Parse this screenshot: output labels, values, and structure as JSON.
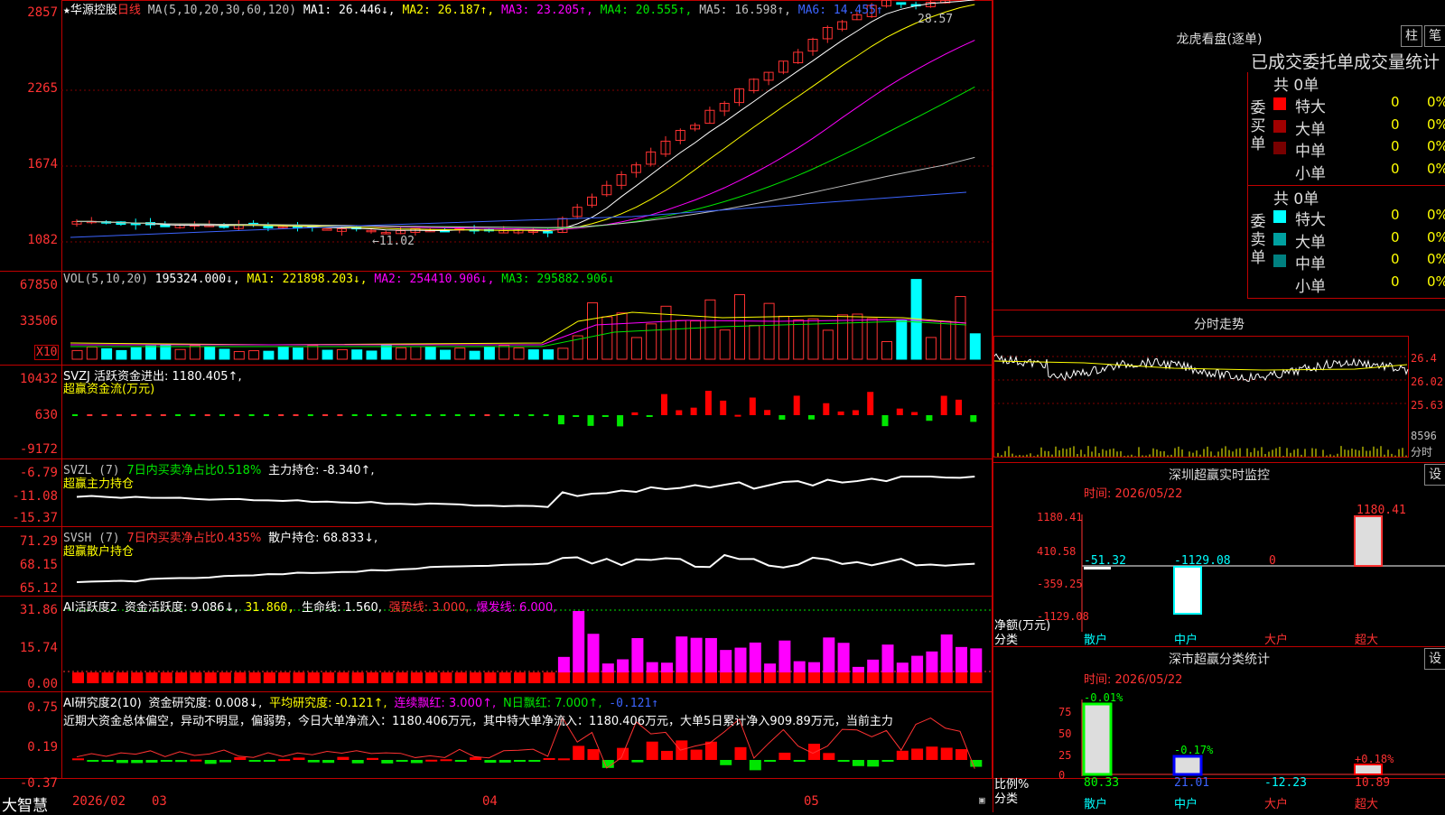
{
  "header": {
    "star": "★",
    "stock_name": "华源控股",
    "period": "日线",
    "ma_params": "MA(5,10,20,30,60,120)",
    "ma": [
      {
        "label": "MA1: 26.446↓,",
        "color": "#ffffff"
      },
      {
        "label": "MA2: 26.187↑,",
        "color": "#ffff00"
      },
      {
        "label": "MA3: 23.205↑,",
        "color": "#ff00ff"
      },
      {
        "label": "MA4: 20.555↑,",
        "color": "#00e600"
      },
      {
        "label": "MA5: 16.598↑,",
        "color": "#c0c0c0"
      },
      {
        "label": "MA6: 14.455↑",
        "color": "#3c64ff"
      }
    ]
  },
  "main_chart": {
    "y_ticks": [
      "2857",
      "2265",
      "1674",
      "1082"
    ],
    "high_label": "28.57",
    "low_label": "←11.02"
  },
  "vol_panel": {
    "title": "VOL(5,10,20)",
    "value": "195324.000↓,",
    "ma1": "MA1: 221898.203↓,",
    "ma2": "MA2: 254410.906↓,",
    "ma3": "MA3: 295882.906↓",
    "y_ticks": [
      "67850",
      "33506"
    ],
    "x10": "X10"
  },
  "svzj_panel": {
    "title": "SVZJ  活跃资金进出: 1180.405↑,",
    "subtitle": "超赢资金流(万元)",
    "y_ticks": [
      "10432",
      "630",
      "-9172"
    ]
  },
  "svzl_panel": {
    "title": "SVZL (7)",
    "ratio": "7日内买卖净占比0.518%",
    "hold": "主力持仓: -8.340↑,",
    "subtitle": "超赢主力持仓",
    "y_ticks": [
      "-6.79",
      "-11.08",
      "-15.37"
    ]
  },
  "svsh_panel": {
    "title": "SVSH (7)",
    "ratio": "7日内买卖净占比0.435%",
    "hold": "散户持仓: 68.833↓,",
    "subtitle": "超赢散户持仓",
    "y_ticks": [
      "71.29",
      "68.15",
      "65.12"
    ]
  },
  "ai2_panel": {
    "title": "AI活跃度2",
    "active": "资金活跃度: 9.086↓,",
    "v1": "31.860,",
    "life": "生命线: 1.560,",
    "strong": "强势线: 3.000,",
    "burst": "爆发线: 6.000,",
    "y_ticks": [
      "31.86",
      "15.74",
      "0.00"
    ]
  },
  "ai_research_panel": {
    "title": "AI研究度2(10)",
    "research": "资金研究度: 0.008↓,",
    "avg": "平均研究度: -0.121↑,",
    "red_days": "连续飘红: 3.000↑,",
    "n_red": "N日飘红: 7.000↑,",
    "last": "-0.121↑",
    "comment": "近期大资金总体偏空，异动不明显，偏弱势，今日大单净流入：1180.406万元，其中特大单净流入：1180.406万元，大单5日累计净入909.89万元，当前主力",
    "y_ticks": [
      "0.75",
      "0.19",
      "-0.37"
    ]
  },
  "x_axis": {
    "brand": "大智慧",
    "labels": [
      "2026/02",
      "03",
      "04",
      "05"
    ]
  },
  "right_panel": {
    "title": "龙虎看盘(逐单)",
    "btn_bar": "柱",
    "btn_tick": "笔",
    "table_title": "已成交委托单成交量统计",
    "buy_caption": [
      "委",
      "买",
      "单"
    ],
    "sell_caption": [
      "委",
      "卖",
      "单"
    ],
    "buy_total": "共 0单",
    "sell_total": "共 0单",
    "buy_rows": [
      {
        "label": "特大",
        "count": "0",
        "pct": "0%",
        "color": "#ff0000"
      },
      {
        "label": "大单",
        "count": "0",
        "pct": "0%",
        "color": "#a00000"
      },
      {
        "label": "中单",
        "count": "0",
        "pct": "0%",
        "color": "#780000"
      },
      {
        "label": "小单",
        "count": "0",
        "pct": "0%",
        "color": ""
      }
    ],
    "sell_rows": [
      {
        "label": "特大",
        "count": "0",
        "pct": "0%",
        "color": "#00ffff"
      },
      {
        "label": "大单",
        "count": "0",
        "pct": "0%",
        "color": "#00a0a0"
      },
      {
        "label": "中单",
        "count": "0",
        "pct": "0%",
        "color": "#008080"
      },
      {
        "label": "小单",
        "count": "0",
        "pct": "0%",
        "color": ""
      }
    ],
    "intraday_title": "分时走势",
    "intraday_ticks": [
      "26.4",
      "26.02",
      "25.63"
    ],
    "intraday_vol": "8596",
    "intraday_label": "分时",
    "monitor_title": "深圳超赢实时监控",
    "monitor_btn": "设",
    "monitor_time": "时间: 2026/05/22",
    "monitor_y": [
      "1180.41",
      "410.58",
      "-359.25",
      "-1129.08"
    ],
    "monitor_values": [
      "-51.32",
      "-1129.08",
      "0",
      "1180.41"
    ],
    "monitor_cats": [
      "散户",
      "中户",
      "大户",
      "超大"
    ],
    "monitor_ylabel": "净额(万元)",
    "monitor_xlabel": "分类",
    "stat_title": "深市超赢分类统计",
    "stat_btn": "设",
    "stat_time": "时间: 2026/05/22",
    "stat_y": [
      "75",
      "50",
      "25",
      "0"
    ],
    "stat_top": [
      "-0.01%",
      "-0.17%",
      "+0.18%"
    ],
    "stat_values": [
      "80.33",
      "21.01",
      "-12.23",
      "10.89"
    ],
    "stat_cats": [
      "散户",
      "中户",
      "大户",
      "超大"
    ],
    "stat_ylabel": "比例%",
    "stat_xlabel": "分类"
  }
}
